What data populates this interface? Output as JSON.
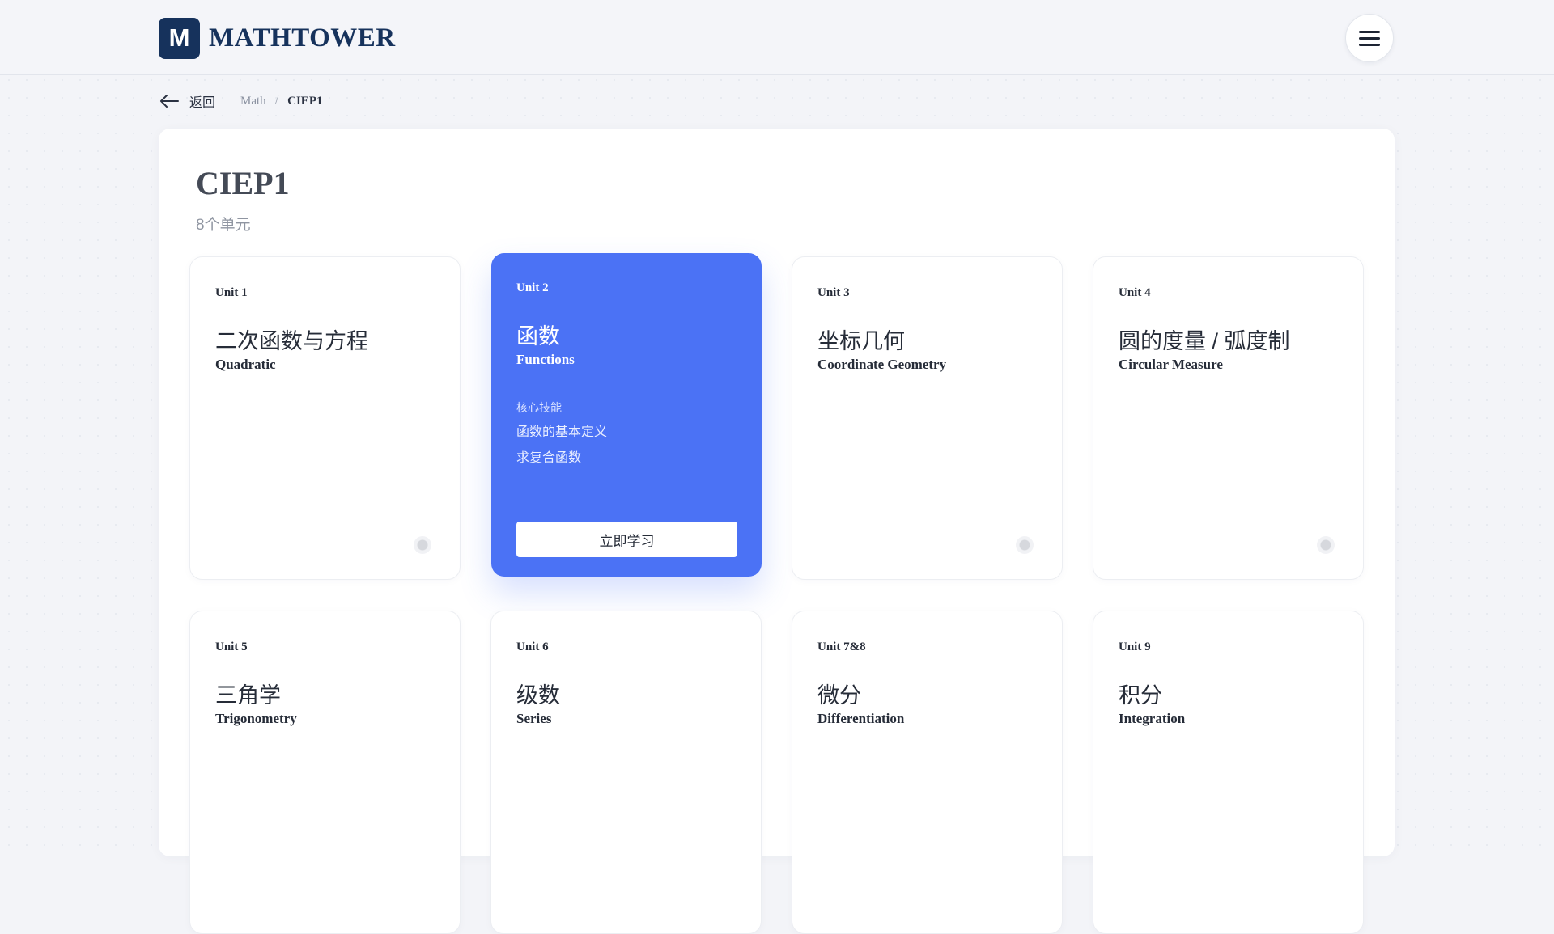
{
  "header": {
    "logo_mark": "M",
    "logo_text": "MATHTOWER",
    "menu_icon": "hamburger-icon"
  },
  "breadcrumb": {
    "back_label": "返回",
    "items": [
      "Math",
      "CIEP1"
    ],
    "separator": "/"
  },
  "page": {
    "title": "CIEP1",
    "subtitle": "8个单元"
  },
  "colors": {
    "brand": "#16325c",
    "accent": "#4b72f5",
    "background": "#f3f4f8"
  },
  "units": [
    {
      "unit": "Unit 1",
      "zh": "二次函数与方程",
      "en": "Quadratic"
    },
    {
      "unit": "Unit 2",
      "zh": "函数",
      "en": "Functions",
      "skills_title": "核心技能",
      "skills": [
        "函数的基本定义",
        "求复合函数"
      ],
      "action": "立即学习"
    },
    {
      "unit": "Unit 3",
      "zh": "坐标几何",
      "en": "Coordinate Geometry"
    },
    {
      "unit": "Unit 4",
      "zh": "圆的度量 / 弧度制",
      "en": "Circular Measure"
    },
    {
      "unit": "Unit 5",
      "zh": "三角学",
      "en": "Trigonometry"
    },
    {
      "unit": "Unit 6",
      "zh": "级数",
      "en": "Series"
    },
    {
      "unit": "Unit 7&8",
      "zh": "微分",
      "en": "Differentiation"
    },
    {
      "unit": "Unit 9",
      "zh": "积分",
      "en": "Integration"
    }
  ]
}
